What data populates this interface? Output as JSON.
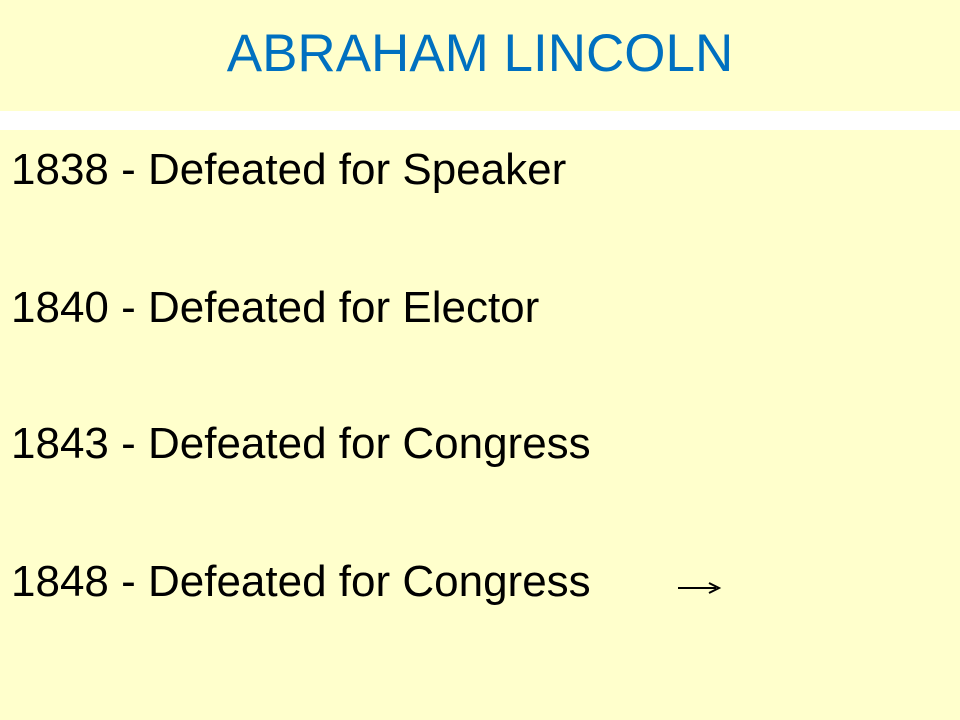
{
  "slide": {
    "title": "ABRAHAM LINCOLN",
    "entries": [
      "1838 - Defeated for Speaker",
      "1840 - Defeated for Elector",
      "1843 - Defeated for Congress",
      "1848 - Defeated for Congress"
    ],
    "continuation_icon": "right-arrow-icon"
  },
  "colors": {
    "background": "#ffffcc",
    "title": "#0070c0",
    "text": "#000000",
    "separator": "#ffffff"
  }
}
